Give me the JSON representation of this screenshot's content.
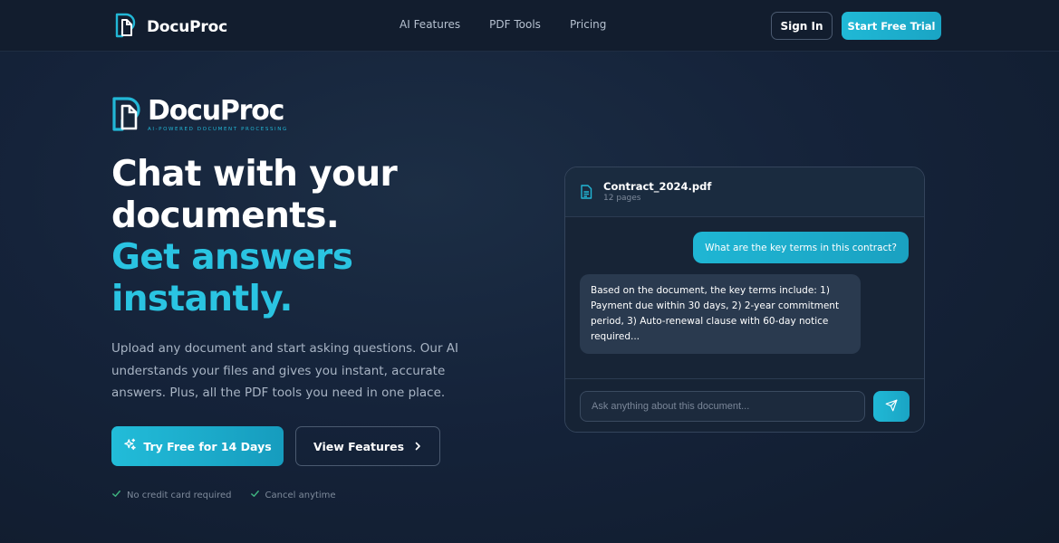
{
  "nav": {
    "brand": "DocuProc",
    "links": [
      "AI Features",
      "PDF Tools",
      "Pricing"
    ],
    "signin_label": "Sign In",
    "trial_label": "Start Free Trial"
  },
  "hero": {
    "logo_wordmark": "DocuProc",
    "logo_tagline": "AI-POWERED DOCUMENT PROCESSING",
    "headline_line1": "Chat with your",
    "headline_line2": "documents.",
    "headline_line3": "Get answers",
    "headline_line4": "instantly.",
    "subtext": "Upload any document and start asking questions. Our AI understands your files and gives you instant, accurate answers. Plus, all the PDF tools you need in one place.",
    "cta_primary": "Try Free for 14 Days",
    "cta_secondary": "View Features",
    "checks": [
      "No credit card required",
      "Cancel anytime"
    ]
  },
  "chat": {
    "file_name": "Contract_2024.pdf",
    "file_pages": "12 pages",
    "user_message": "What are the key terms in this contract?",
    "ai_message": "Based on the document, the key terms include: 1) Payment due within 30 days, 2) 2-year commitment period, 3) Auto-renewal clause with 60-day notice required...",
    "input_placeholder": "Ask anything about this document..."
  },
  "colors": {
    "accent": "#22b7d6",
    "background": "#15233a",
    "navbar": "#121d2e"
  }
}
